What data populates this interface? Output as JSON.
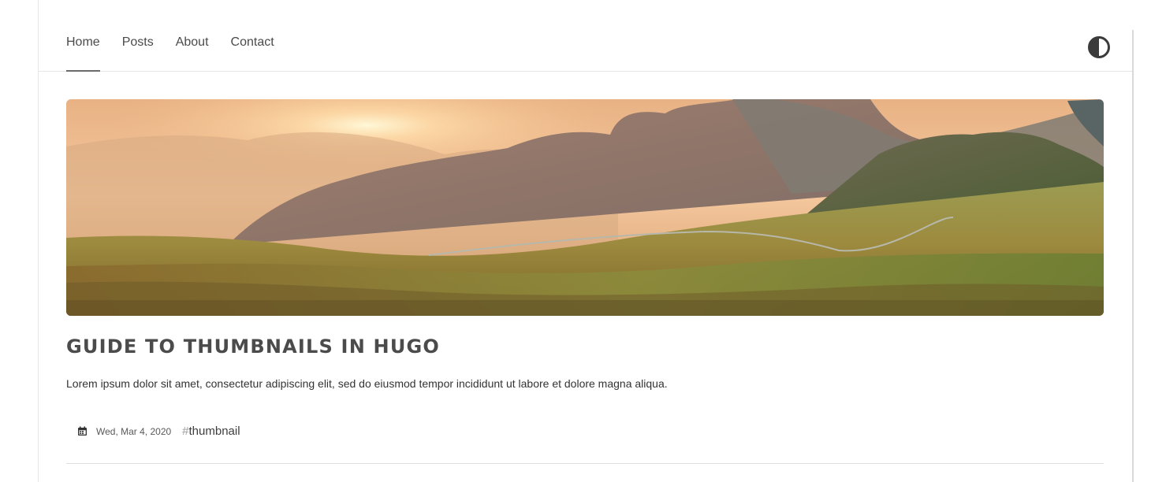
{
  "nav": {
    "items": [
      {
        "label": "Home",
        "active": true
      },
      {
        "label": "Posts",
        "active": false
      },
      {
        "label": "About",
        "active": false
      },
      {
        "label": "Contact",
        "active": false
      }
    ],
    "theme_toggle_icon": "contrast-icon"
  },
  "post": {
    "image_icon": "landscape-thumbnail-image",
    "title": "GUIDE TO THUMBNAILS IN HUGO",
    "summary": "Lorem ipsum dolor sit amet, consectetur adipiscing elit, sed do eiusmod tempor incididunt ut labore et dolore magna aliqua.",
    "date": "Wed, Mar 4, 2020",
    "date_icon": "calendar-icon",
    "tag_hash": "#",
    "tag": "thumbnail"
  },
  "colors": {
    "text": "#4a4a4a",
    "border": "#e5e5e5",
    "title": "#4b4b4b"
  }
}
